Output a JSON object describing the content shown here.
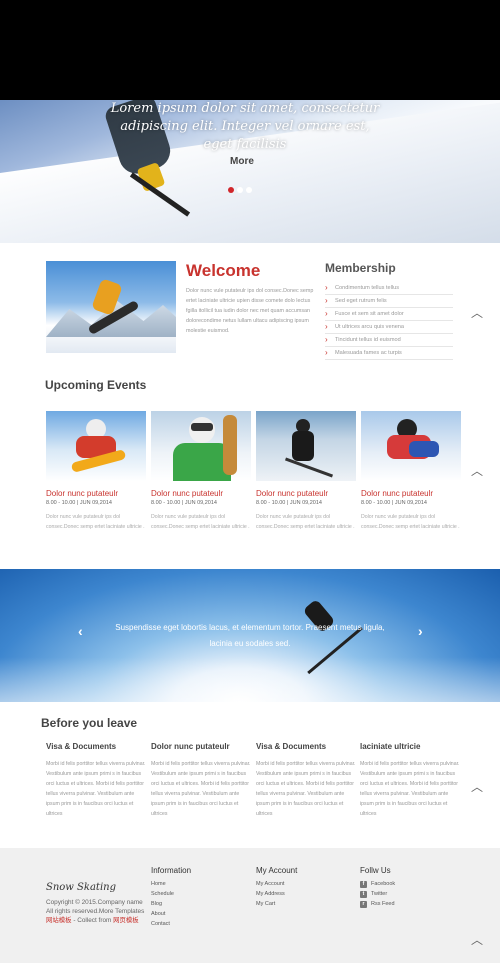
{
  "hero": {
    "caption": "Lorem ipsum dolor sit amet, consectetur adipiscing elit. Integer vel ornare est, eget facilisis",
    "more_label": "More",
    "slide_count": 3,
    "active_slide": 1
  },
  "welcome": {
    "title": "Welcome",
    "text": "Dolor nunc vule putateulr ips dol consec.Donec semp ertet laciniate ultricie upien disse comete dolo lectus fgilla itollicil tua iudin dolor nec met quam accumsan dolorecondime netus lullam ultacu adipiscing ipsum molestie euismod."
  },
  "membership": {
    "title": "Membership",
    "items": [
      "Condimentum tellus tellus",
      "Sed eget rutrum felis",
      "Fusce et sem sit amet dolor",
      "Ut ultrices arcu quis venena",
      "Tincidunt tellus id euismod",
      "Malesuada fames ac turpis"
    ]
  },
  "events": {
    "title": "Upcoming Events",
    "items": [
      {
        "title": "Dolor nunc putateulr",
        "date": "8.00 - 10.00 | JUN 09,2014",
        "text": "Dolor nunc vule putateulr ips dol consec.Donec semp ertet laciniate ultricie ."
      },
      {
        "title": "Dolor nunc putateulr",
        "date": "8.00 - 10.00 | JUN 09,2014",
        "text": "Dolor nunc vule putateulr ips dol consec.Donec semp ertet laciniate ultricie ."
      },
      {
        "title": "Dolor nunc putateulr",
        "date": "8.00 - 10.00 | JUN 09,2014",
        "text": "Dolor nunc vule putateulr ips dol consec.Donec semp ertet laciniate ultricie ."
      },
      {
        "title": "Dolor nunc putateulr",
        "date": "8.00 - 10.00 | JUN 09,2014",
        "text": "Dolor nunc vule putateulr ips dol consec.Donec semp ertet laciniate ultricie ."
      }
    ]
  },
  "banner": {
    "text": "Suspendisse eget lobortis lacus, et elementum tortor. Praesent metus ligula, lacinia eu sodales sed."
  },
  "before_leave": {
    "title": "Before you leave",
    "columns": [
      {
        "title": "Visa & Documents",
        "text": "Morbi id felis porttitor tellus viverra pulvinar. Vestibulum ante ipsum primi s in faucibus orci luctus et ultrices. Morbi id felis porttitor tellus viverra pulvinar. Vestibulum ante ipsum prim is in faucibus orci luctus et ultrices"
      },
      {
        "title": "Dolor nunc putateulr",
        "text": "Morbi id felis porttitor tellus viverra pulvinar. Vestibulum ante ipsum primi s in faucibus orci luctus et ultrices. Morbi id felis porttitor tellus viverra pulvinar. Vestibulum ante ipsum prim is in faucibus orci luctus et ultrices"
      },
      {
        "title": "Visa & Documents",
        "text": "Morbi id felis porttitor tellus viverra pulvinar. Vestibulum ante ipsum primi s in faucibus orci luctus et ultrices. Morbi id felis porttitor tellus viverra pulvinar. Vestibulum ante ipsum prim is in faucibus orci luctus et ultrices"
      },
      {
        "title": "laciniate ultricie",
        "text": "Morbi id felis porttitor tellus viverra pulvinar. Vestibulum ante ipsum primi s in faucibus orci luctus et ultrices. Morbi id felis porttitor tellus viverra pulvinar. Vestibulum ante ipsum prim is in faucibus orci luctus et ultrices"
      }
    ]
  },
  "footer": {
    "logo": "Snow Skating",
    "copyright_prefix": "Copyright © 2015.Company name All rights reserved.More Templates ",
    "copyright_link1": "网站模板",
    "copyright_mid": " - Collect from ",
    "copyright_link2": "网页模板",
    "information": {
      "title": "Information",
      "links": [
        "Home",
        "Schedule",
        "Blog",
        "About",
        "Contact"
      ]
    },
    "account": {
      "title": "My Account",
      "links": [
        "My Account",
        "My Address",
        "My Cart"
      ]
    },
    "follow": {
      "title": "Follw Us",
      "links": [
        {
          "label": "Facebook",
          "icon": "facebook-icon",
          "glyph": "f"
        },
        {
          "label": "Twitter",
          "icon": "twitter-icon",
          "glyph": "t"
        },
        {
          "label": "Rss Feed",
          "icon": "rss-icon",
          "glyph": "r"
        }
      ]
    }
  },
  "colors": {
    "accent": "#c8332e",
    "footer_bg": "#f0f0f0",
    "top_bar": "#000000"
  }
}
